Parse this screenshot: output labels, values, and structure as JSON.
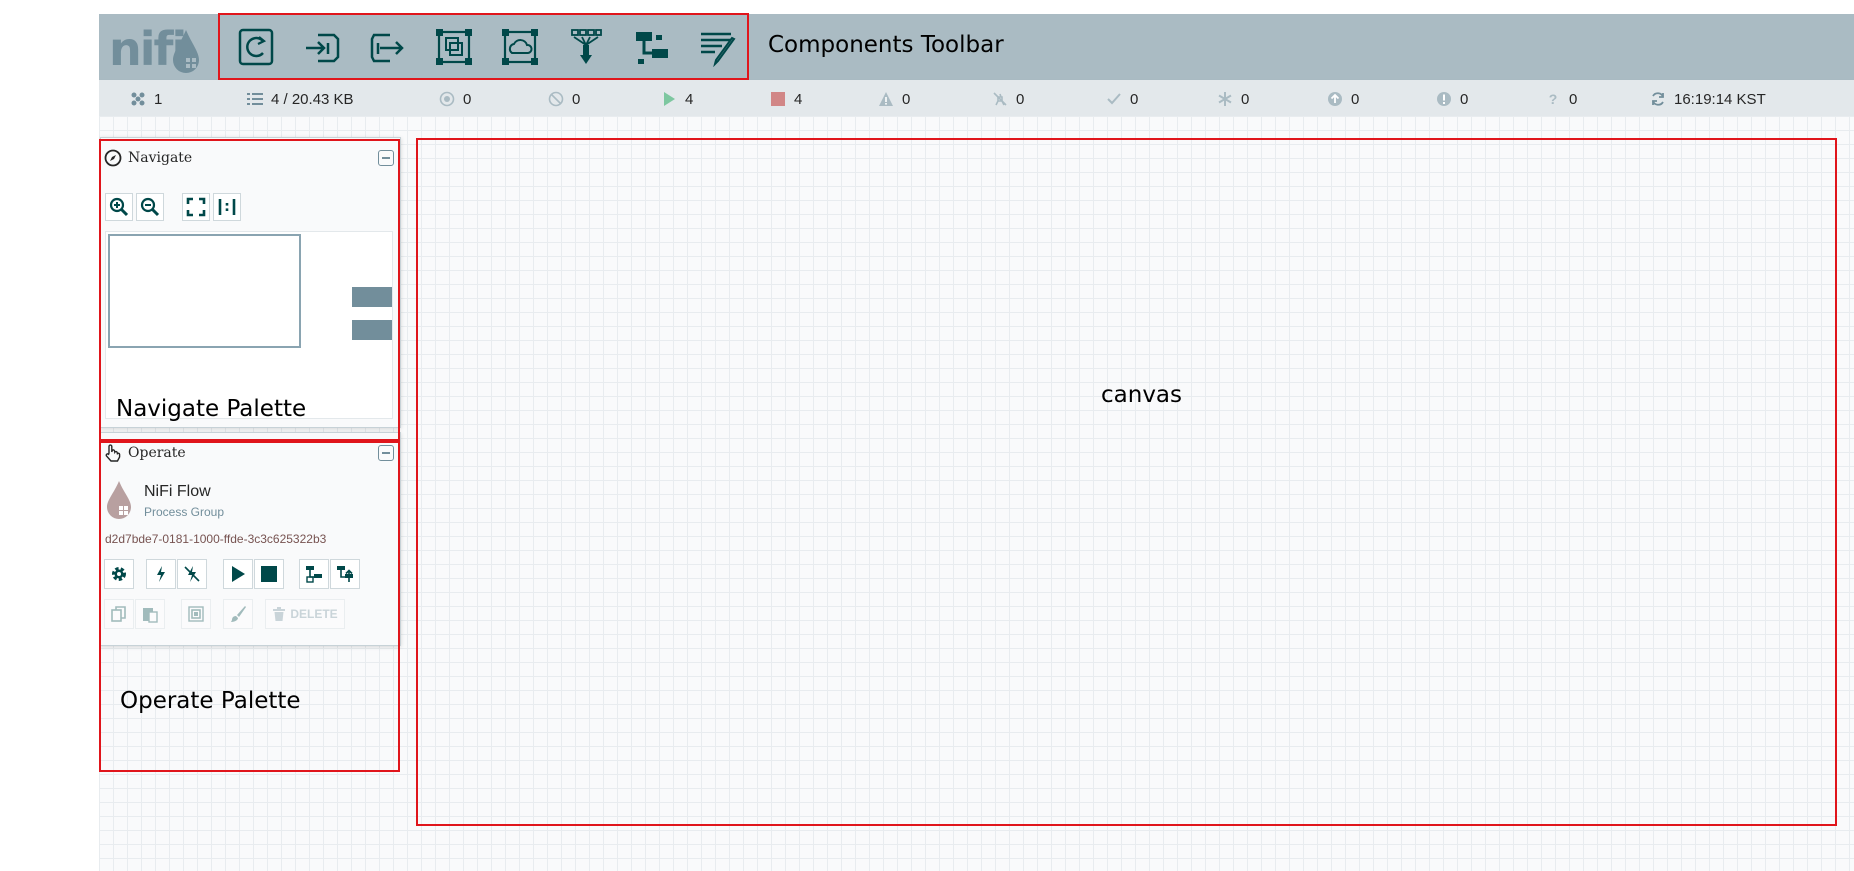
{
  "app": {
    "logo_text": "nifi"
  },
  "toolbar": {
    "items": [
      {
        "icon": "processor-icon"
      },
      {
        "icon": "input-port-icon"
      },
      {
        "icon": "output-port-icon"
      },
      {
        "icon": "process-group-icon"
      },
      {
        "icon": "remote-process-group-icon"
      },
      {
        "icon": "funnel-icon"
      },
      {
        "icon": "template-icon"
      },
      {
        "icon": "label-icon"
      }
    ]
  },
  "status": {
    "cluster_count": "1",
    "queued": "4 / 20.43 KB",
    "transmitting": "0",
    "not_transmitting": "0",
    "running": "4",
    "stopped": "4",
    "invalid": "0",
    "disabled": "0",
    "up_to_date": "0",
    "locally_modified": "0",
    "stale": "0",
    "locally_modified_stale": "0",
    "sync_failure": "0",
    "last_refreshed": "16:19:14 KST"
  },
  "colors": {
    "running": "#7dc7a0",
    "stopped": "#d18686",
    "brand": "#728e9b",
    "header": "#aabbc3"
  },
  "navigate": {
    "title": "Navigate"
  },
  "operate": {
    "title": "Operate",
    "selection_name": "NiFi Flow",
    "selection_type": "Process Group",
    "selection_id": "d2d7bde7-0181-1000-ffde-3c3c625322b3",
    "delete_label": "DELETE"
  },
  "annotations": {
    "components_toolbar": "Components Toolbar",
    "navigate_palette": "Navigate Palette",
    "operate_palette": "Operate Palette",
    "canvas": "canvas"
  }
}
